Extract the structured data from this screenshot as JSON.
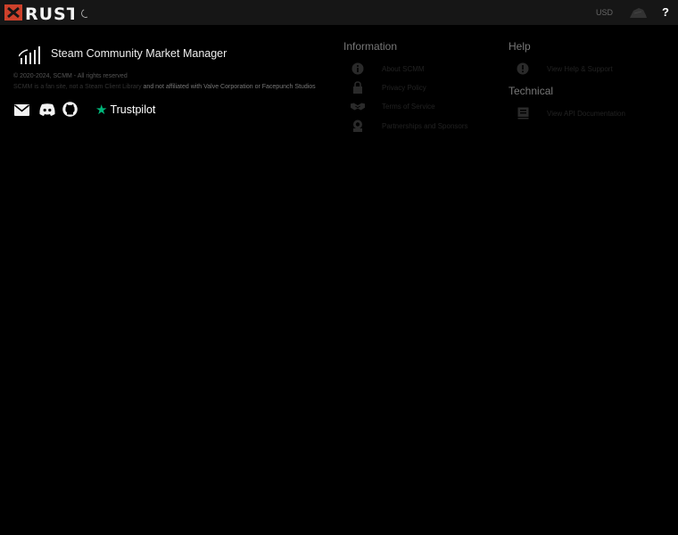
{
  "topbar": {
    "logo_text": "RUST",
    "currency": "USD",
    "help_label": "?"
  },
  "footer": {
    "brand_name": "Steam Community Market Manager",
    "copyright": "© 2020-2024, SCMM - All rights reserved",
    "disclaimer_prefix": "SCMM is a fan site, not a",
    "disclaimer_mid": "Steam Client Library",
    "disclaimer_suffix": "and not affiliated with Valve Corporation or Facepunch Studios",
    "trustpilot_label": "Trustpilot"
  },
  "columns": {
    "information": {
      "title": "Information",
      "links": [
        {
          "label": "About SCMM",
          "icon": "info-icon"
        },
        {
          "label": "Privacy Policy",
          "icon": "privacy-icon"
        },
        {
          "label": "Terms of Service",
          "icon": "handshake-icon"
        },
        {
          "label": "Partnerships and Sponsors",
          "icon": "award-icon"
        }
      ]
    },
    "help": {
      "title": "Help",
      "links": [
        {
          "label": "View Help & Support",
          "icon": "question-icon"
        }
      ]
    },
    "technical": {
      "title": "Technical",
      "links": [
        {
          "label": "View API Documentation",
          "icon": "book-icon"
        }
      ]
    }
  },
  "colors": {
    "topbar_bg": "#161616",
    "logo_red": "#cd412b",
    "trustpilot_green": "#00b67a"
  }
}
